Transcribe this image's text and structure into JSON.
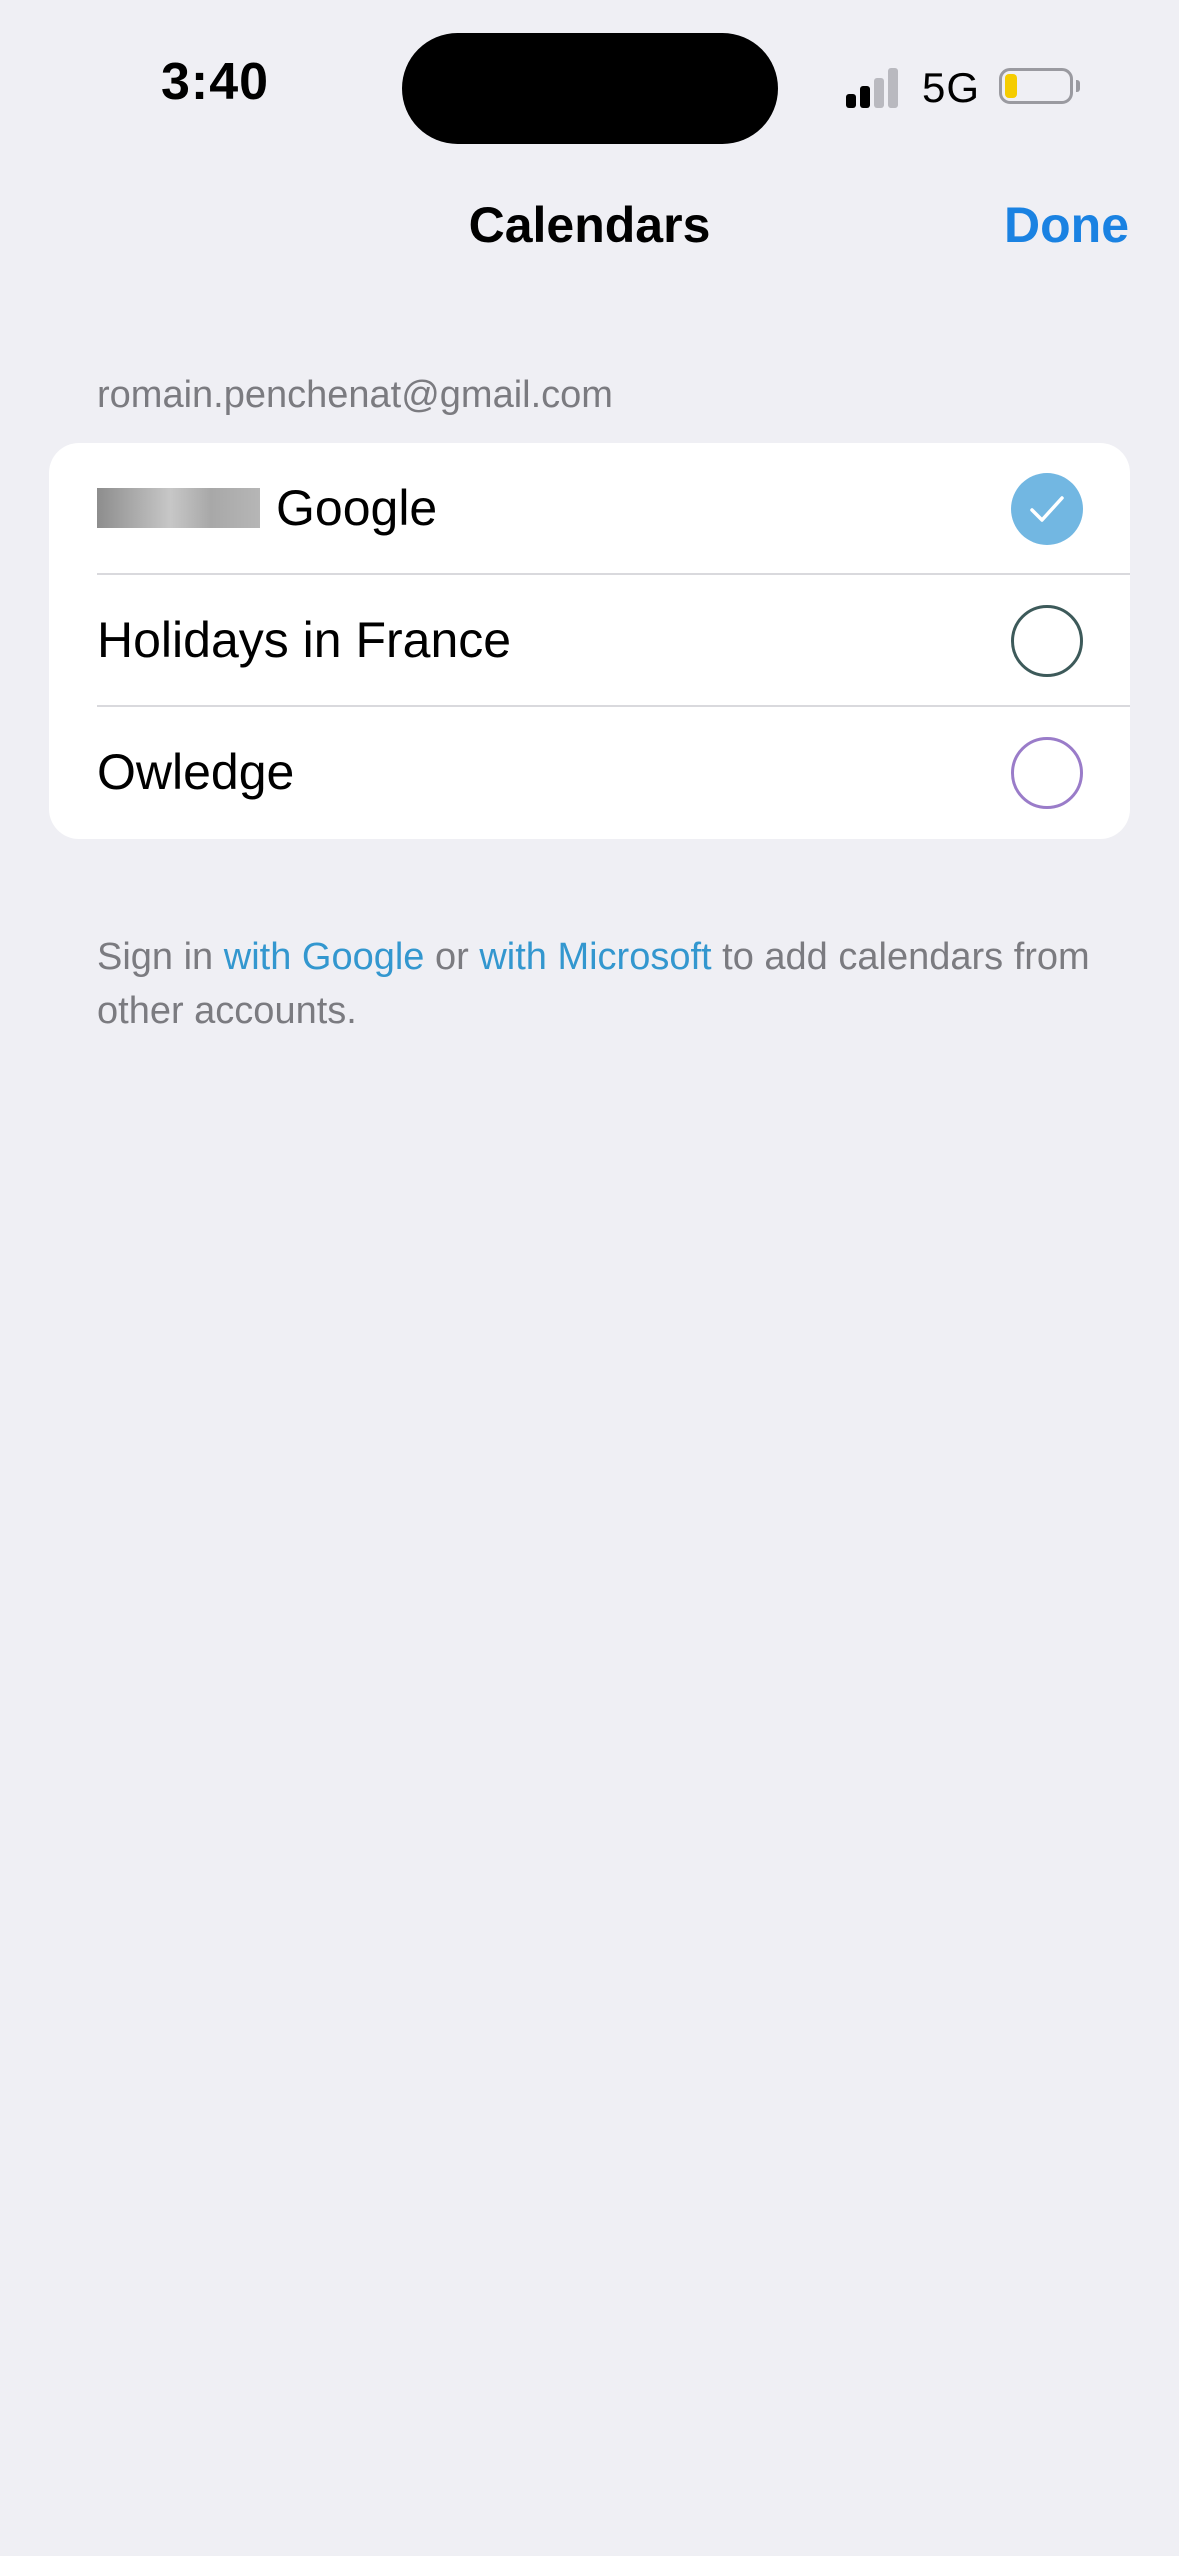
{
  "status_bar": {
    "time": "3:40",
    "network": "5G",
    "signal_bars_active": 2,
    "signal_bars_total": 4,
    "battery_level": 0.15,
    "battery_color": "#f5cc00"
  },
  "nav": {
    "title": "Calendars",
    "done_label": "Done"
  },
  "account": {
    "email": "romain.penchenat@gmail.com"
  },
  "calendars": [
    {
      "label": "Google",
      "checked": true,
      "color": "#72b7e2",
      "redacted_prefix": true
    },
    {
      "label": "Holidays in France",
      "checked": false,
      "color": "#3d5a5a"
    },
    {
      "label": "Owledge",
      "checked": false,
      "color": "#9a7cc9"
    }
  ],
  "footer": {
    "prefix": "Sign in ",
    "google_link": "with Google",
    "middle": " or ",
    "microsoft_link": "with Microsoft",
    "suffix": " to add calendars from other accounts."
  },
  "colors": {
    "accent": "#1a82e2",
    "link": "#3397cf",
    "background": "#efeff4"
  }
}
